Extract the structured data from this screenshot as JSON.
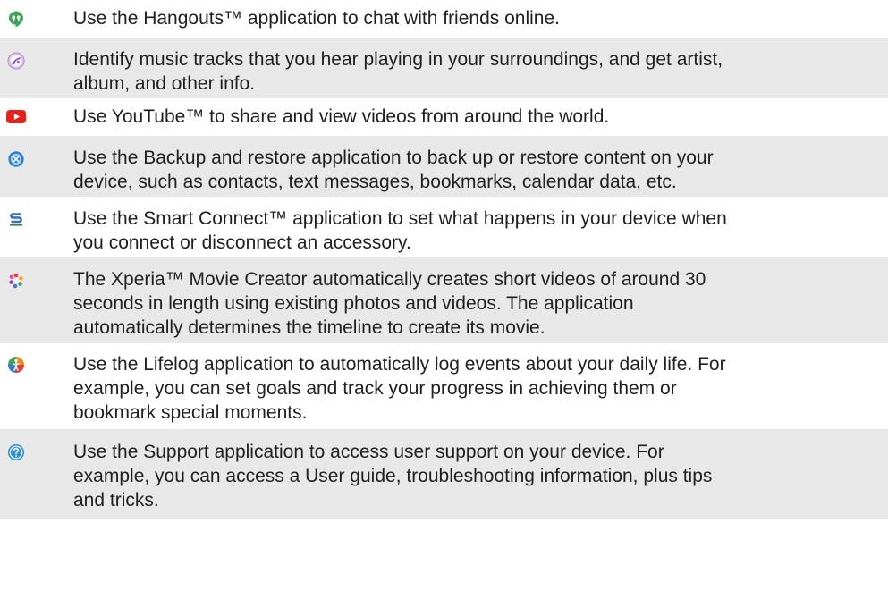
{
  "items": [
    {
      "icon": "hangouts-icon",
      "lines": [
        "Use the Hangouts™ application to chat with friends online."
      ]
    },
    {
      "icon": "trackid-icon",
      "lines": [
        "Identify music tracks that you hear playing in your surroundings, and get artist,",
        "album, and other info."
      ]
    },
    {
      "icon": "youtube-icon",
      "lines": [
        "Use YouTube™ to share and view videos from around the world."
      ]
    },
    {
      "icon": "backup-restore-icon",
      "lines": [
        "Use the Backup and restore application to back up or restore content on your",
        "device, such as contacts, text messages, bookmarks, calendar data, etc."
      ]
    },
    {
      "icon": "smart-connect-icon",
      "lines": [
        "Use the Smart Connect™ application to set what happens in your device when",
        "you connect or disconnect an accessory."
      ]
    },
    {
      "icon": "movie-creator-icon",
      "lines": [
        "The Xperia™ Movie Creator automatically creates short videos of around 30",
        "seconds in length using existing photos and videos. The application",
        "automatically determines the timeline to create its movie."
      ]
    },
    {
      "icon": "lifelog-icon",
      "lines": [
        "Use the Lifelog application to automatically log events about your daily life. For",
        "example, you can set goals and track your progress in achieving them or",
        "bookmark special moments."
      ]
    },
    {
      "icon": "support-icon",
      "lines": [
        "Use the Support application to access user support on your device. For",
        "example, you can access a User guide, troubleshooting information, plus tips",
        "and tricks."
      ]
    }
  ],
  "colors": {
    "hangouts": "#3fa45b",
    "trackid": "#a23fd1",
    "youtube": "#e62117",
    "backup": "#2a7ec9",
    "smart_connect": "#3a6fb5",
    "lifelog": "#f08a24",
    "support": "#2d8fd5",
    "row_shade": "#e8e8e8"
  }
}
